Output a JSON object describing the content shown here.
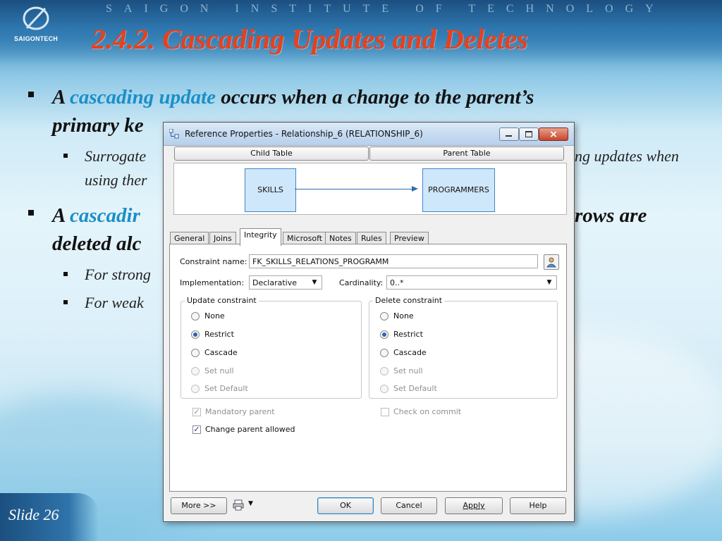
{
  "slide": {
    "institute": "SAIGON INSTITUTE OF TECHNOLOGY",
    "logo_text": "SAIGONTECH",
    "title": "2.4.2.  Cascading Updates and Deletes",
    "bullet1": {
      "a": "A",
      "highlight": "cascading update",
      "rest": "occurs when a change to the parent’s",
      "line2": "primary ke"
    },
    "sub1": {
      "line1_a": "Surrogate",
      "line1_b": "ng updates when",
      "line2": "using ther"
    },
    "bullet2": {
      "a": "A",
      "highlight": "cascadir",
      "rest": "rows are",
      "line2": "deleted alc"
    },
    "sub2": "For strong",
    "sub3": "For weak",
    "slide_number": "Slide 26"
  },
  "dialog": {
    "title": "Reference Properties - Relationship_6 (RELATIONSHIP_6)",
    "child_table_label": "Child Table",
    "parent_table_label": "Parent Table",
    "child_entity": "SKILLS",
    "parent_entity": "PROGRAMMERS",
    "tabs": [
      "General",
      "Joins",
      "Integrity",
      "Microsoft",
      "Notes",
      "Rules",
      "Preview"
    ],
    "active_tab": "Integrity",
    "constraint_name_label": "Constraint name:",
    "constraint_name_value": "FK_SKILLS_RELATIONS_PROGRAMM",
    "implementation_label": "Implementation:",
    "implementation_value": "Declarative",
    "cardinality_label": "Cardinality:",
    "cardinality_value": "0..*",
    "update_group_title": "Update constraint",
    "delete_group_title": "Delete constraint",
    "update_options": [
      {
        "label": "None",
        "selected": false,
        "enabled": true
      },
      {
        "label": "Restrict",
        "selected": true,
        "enabled": true
      },
      {
        "label": "Cascade",
        "selected": false,
        "enabled": true
      },
      {
        "label": "Set null",
        "selected": false,
        "enabled": false
      },
      {
        "label": "Set Default",
        "selected": false,
        "enabled": false
      }
    ],
    "delete_options": [
      {
        "label": "None",
        "selected": false,
        "enabled": true
      },
      {
        "label": "Restrict",
        "selected": true,
        "enabled": true
      },
      {
        "label": "Cascade",
        "selected": false,
        "enabled": true
      },
      {
        "label": "Set null",
        "selected": false,
        "enabled": false
      },
      {
        "label": "Set Default",
        "selected": false,
        "enabled": false
      }
    ],
    "mandatory_parent_label": "Mandatory parent",
    "change_parent_label": "Change parent allowed",
    "check_on_commit_label": "Check on commit",
    "buttons": {
      "more": "More >>",
      "ok": "OK",
      "cancel": "Cancel",
      "apply": "Apply",
      "help": "Help"
    }
  }
}
